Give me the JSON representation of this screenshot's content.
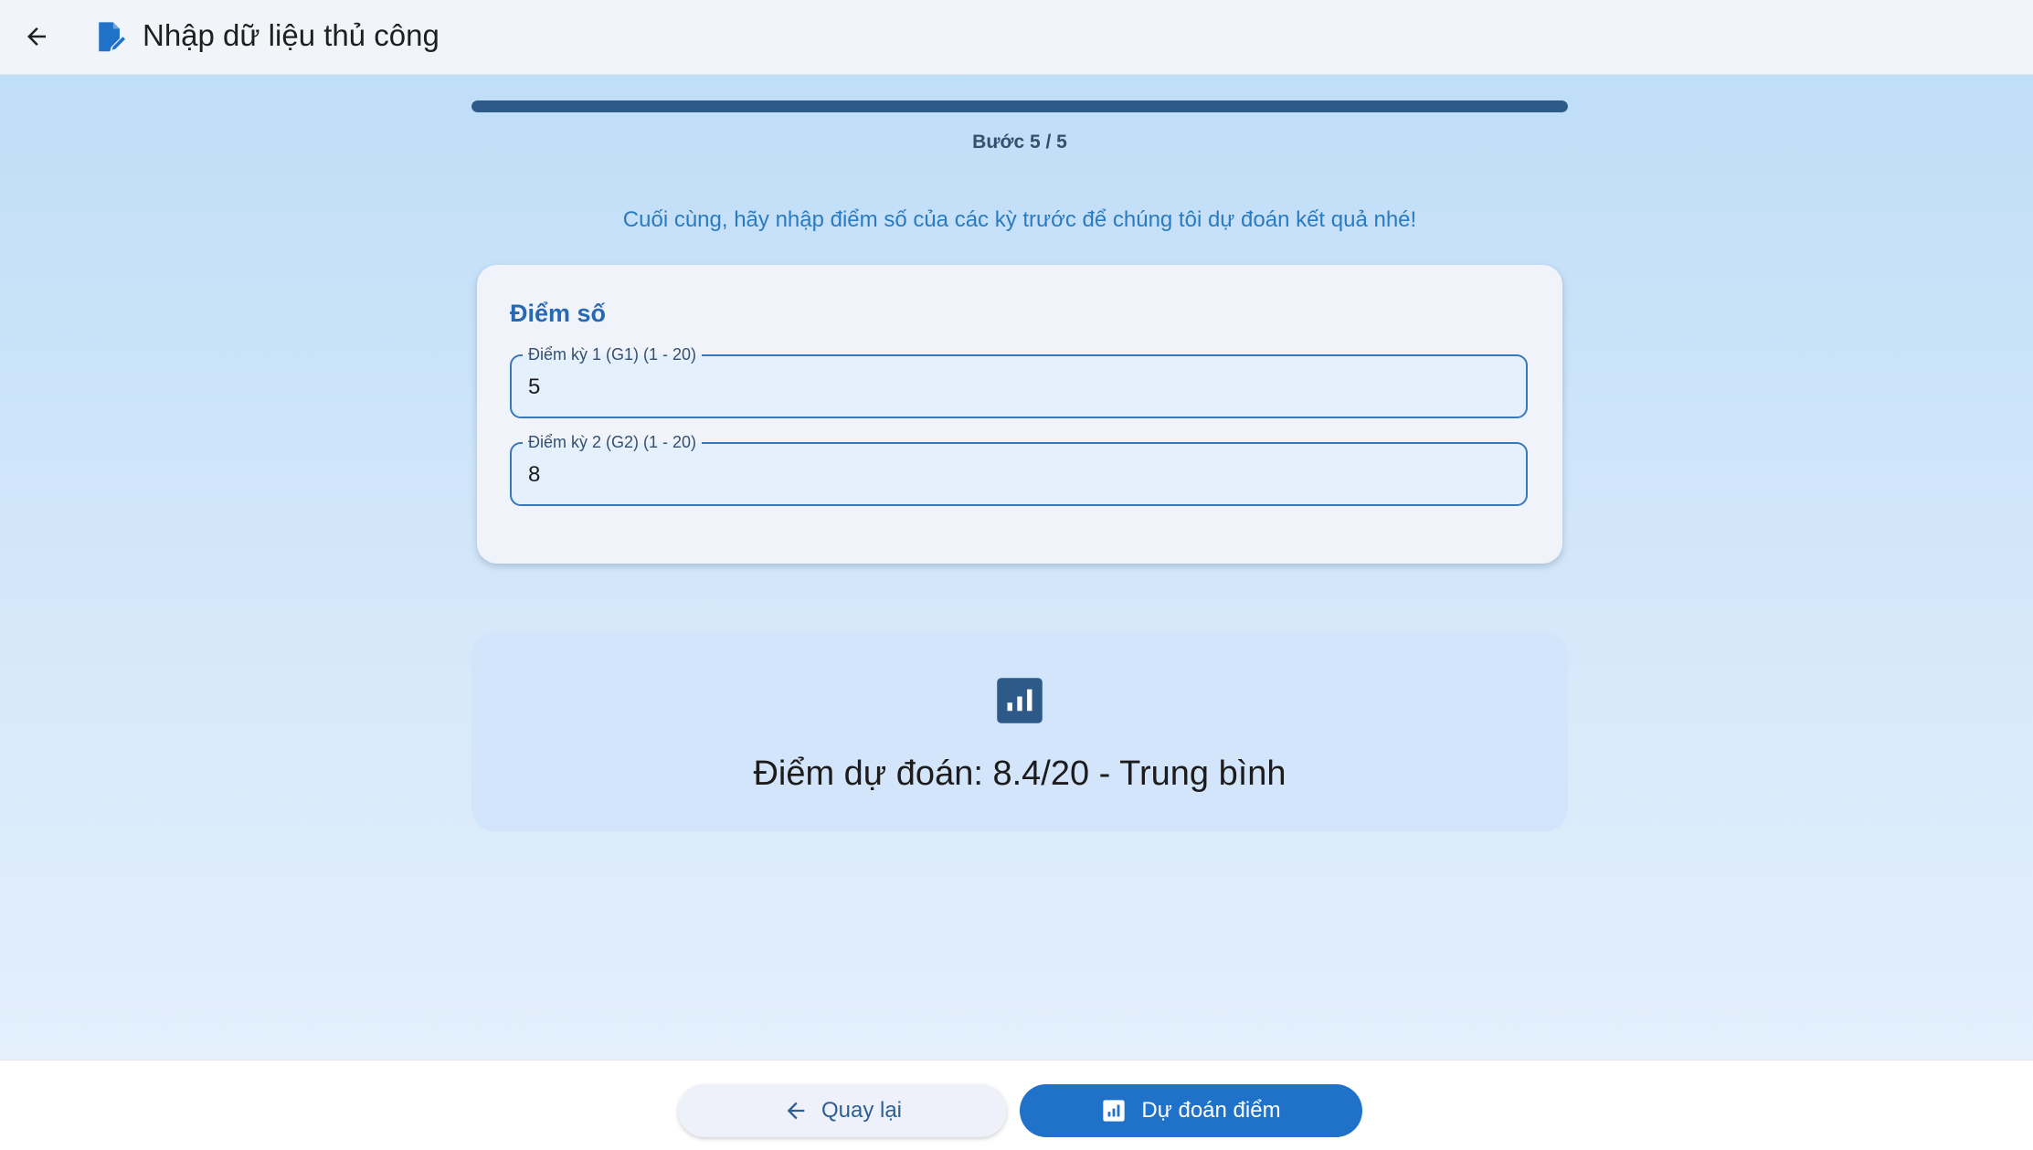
{
  "header": {
    "title": "Nhập dữ liệu thủ công",
    "back_icon": "arrow-left-icon",
    "title_icon": "edit-document-icon"
  },
  "progress": {
    "step_text": "Bước 5 / 5",
    "fraction": 1.0
  },
  "intro_text": "Cuối cùng, hãy nhập điểm số của các kỳ trước để chúng tôi dự đoán kết quả nhé!",
  "scores_card": {
    "title": "Điểm số",
    "fields": [
      {
        "label": "Điểm kỳ 1 (G1) (1 - 20)",
        "value": "5"
      },
      {
        "label": "Điểm kỳ 2 (G2) (1 - 20)",
        "value": "8"
      }
    ]
  },
  "result": {
    "icon": "bar-chart-icon",
    "text": "Điểm dự đoán: 8.4/20 - Trung bình"
  },
  "footer": {
    "back_label": "Quay lại",
    "predict_label": "Dự đoán điểm"
  },
  "colors": {
    "primary": "#1f72c8",
    "progress": "#2e5a8a",
    "accent_text": "#2a7bc0",
    "card_title": "#2768b3"
  }
}
